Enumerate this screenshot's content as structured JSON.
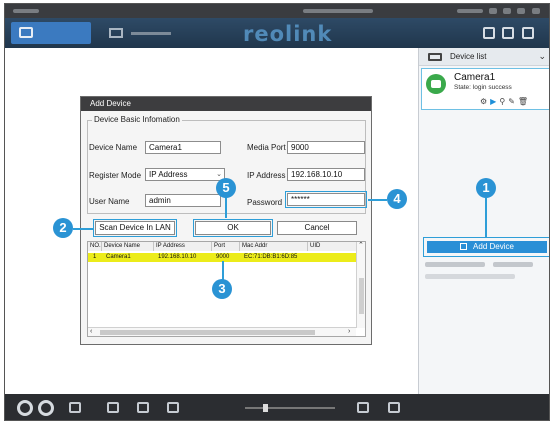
{
  "app": {
    "logo": "reolink"
  },
  "device_panel": {
    "header": "Device list",
    "camera": {
      "name": "Camera1",
      "state": "State: login success"
    },
    "add_button": "Add Device"
  },
  "dialog": {
    "title": "Add Device",
    "section": "Device Basic Infomation",
    "labels": {
      "device_name": "Device Name",
      "media_port": "Media Port",
      "register_mode": "Register Mode",
      "ip_address": "IP Address",
      "user_name": "User Name",
      "password": "Password"
    },
    "values": {
      "device_name": "Camera1",
      "media_port": "9000",
      "register_mode": "IP Address",
      "ip_address": "192.168.10.10",
      "user_name": "admin",
      "password": "******"
    },
    "buttons": {
      "scan": "Scan Device In LAN",
      "ok": "OK",
      "cancel": "Cancel"
    },
    "table": {
      "columns": [
        "NO.",
        "Device Name",
        "IP Address",
        "Port",
        "Mac Addr",
        "UID"
      ],
      "rows": [
        [
          "1",
          "Camera1",
          "192.168.10.10",
          "9000",
          "EC:71:DB:B1:6D:85",
          ""
        ]
      ]
    }
  },
  "callouts": [
    "1",
    "2",
    "3",
    "4",
    "5"
  ],
  "colors": {
    "accent": "#2a93d4",
    "highlight_row": "#ecec1a",
    "status_green": "#3aa94b"
  }
}
